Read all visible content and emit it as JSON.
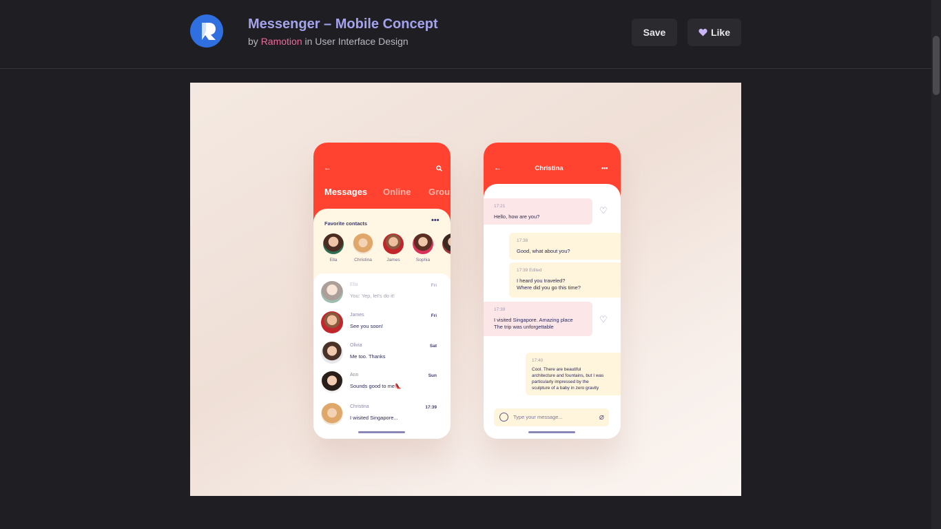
{
  "header": {
    "title": "Messenger – Mobile Concept",
    "by": "by",
    "author": "Ramotion",
    "in_text": "in User Interface Design",
    "save_label": "Save",
    "like_label": "Like"
  },
  "icons": {
    "logo": "ramotion-logo",
    "like": "heart-icon",
    "back": "arrow-left-icon",
    "search": "search-icon",
    "more": "more-dots-icon"
  },
  "messages_screen": {
    "tabs": [
      "Messages",
      "Online",
      "Grou"
    ],
    "favorites_title": "Favorite contacts",
    "favorites": [
      "Ella",
      "Christina",
      "James",
      "Sophia",
      "Ol"
    ],
    "conversations": [
      {
        "name": "Ella",
        "message": "You: Yep, let's do it!",
        "day": "Fri"
      },
      {
        "name": "James",
        "message": "See you soon!",
        "day": "Fri"
      },
      {
        "name": "Olivia",
        "message": "Me too. Thanks",
        "day": "Sat"
      },
      {
        "name": "Ann",
        "message": "Sounds good to me👠",
        "day": "Sun"
      },
      {
        "name": "Christina",
        "message": "I wisited Singapore...",
        "day": "17:39"
      }
    ]
  },
  "chat_screen": {
    "contact": "Christina",
    "bubbles": [
      {
        "time": "17:21",
        "line1": "Hello, how are you?",
        "line2": ""
      },
      {
        "time": "17:38",
        "line1": "Good, what about you?",
        "line2": ""
      },
      {
        "time": "17:39  Edited",
        "line1": "I heard you traveled?",
        "line2": "Where did you go this time?"
      },
      {
        "time": "17:39",
        "line1": "I visited Singapore. Amazing place",
        "line2": "The trip was unforgettable"
      },
      {
        "time": "17:40",
        "line1": "Cool. There are beautiful",
        "line2": "architecture and fountains, but I was",
        "line3": "particularly impressed by the",
        "line4": "sculpture of a baby in zero gravity"
      }
    ],
    "input_placeholder": "Type your message..."
  },
  "colors": {
    "brand_red": "#ff4330",
    "accent_purple": "#a3a3ee",
    "author_pink": "#ea6a9b",
    "logo_blue": "#2f6fe0"
  }
}
